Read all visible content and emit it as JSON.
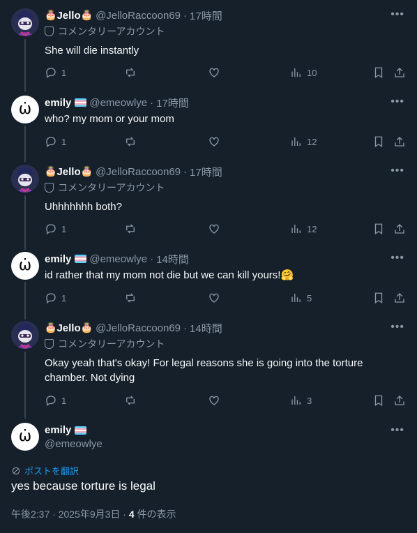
{
  "tweets": [
    {
      "name": "Jello",
      "name_emoji": "🎂",
      "handle": "@JelloRaccoon69",
      "time": "17時間",
      "label": "コメンタリーアカウント",
      "text": "She will die instantly",
      "replies": "1",
      "views": "10"
    },
    {
      "name": "emily",
      "handle": "@emeowlye",
      "time": "17時間",
      "text": "who? my mom or your mom",
      "replies": "1",
      "views": "12"
    },
    {
      "name": "Jello",
      "name_emoji": "🎂",
      "handle": "@JelloRaccoon69",
      "time": "17時間",
      "label": "コメンタリーアカウント",
      "text": "Uhhhhhhh both?",
      "replies": "1",
      "views": "12"
    },
    {
      "name": "emily",
      "handle": "@emeowlye",
      "time": "14時間",
      "text": "id rather that my mom not die but we can kill yours!🤗",
      "replies": "1",
      "views": "5"
    },
    {
      "name": "Jello",
      "name_emoji": "🎂",
      "handle": "@JelloRaccoon69",
      "time": "14時間",
      "label": "コメンタリーアカウント",
      "text_line1": "Okay yeah that's okay! For legal reasons she is going into the torture",
      "text_line2": "chamber. Not dying",
      "replies": "1",
      "views": "3"
    }
  ],
  "main": {
    "name": "emily",
    "handle": "@emeowlye",
    "translate": "ポストを翻訳",
    "text": "yes because torture is legal",
    "timestamp": "午後2:37 · 2025年9月3日 · ",
    "views_count": "4",
    "views_label": " 件の表示"
  },
  "icons": {
    "more": "more-icon",
    "reply": "reply-icon",
    "retweet": "retweet-icon",
    "like": "heart-icon",
    "views": "views-icon",
    "bookmark": "bookmark-icon",
    "share": "share-icon"
  },
  "avatar_glyph": "ω̇",
  "colors": {
    "background": "#15202b",
    "text": "#f7f9f9",
    "secondary": "#8b98a5",
    "accent": "#1d9bf0"
  }
}
